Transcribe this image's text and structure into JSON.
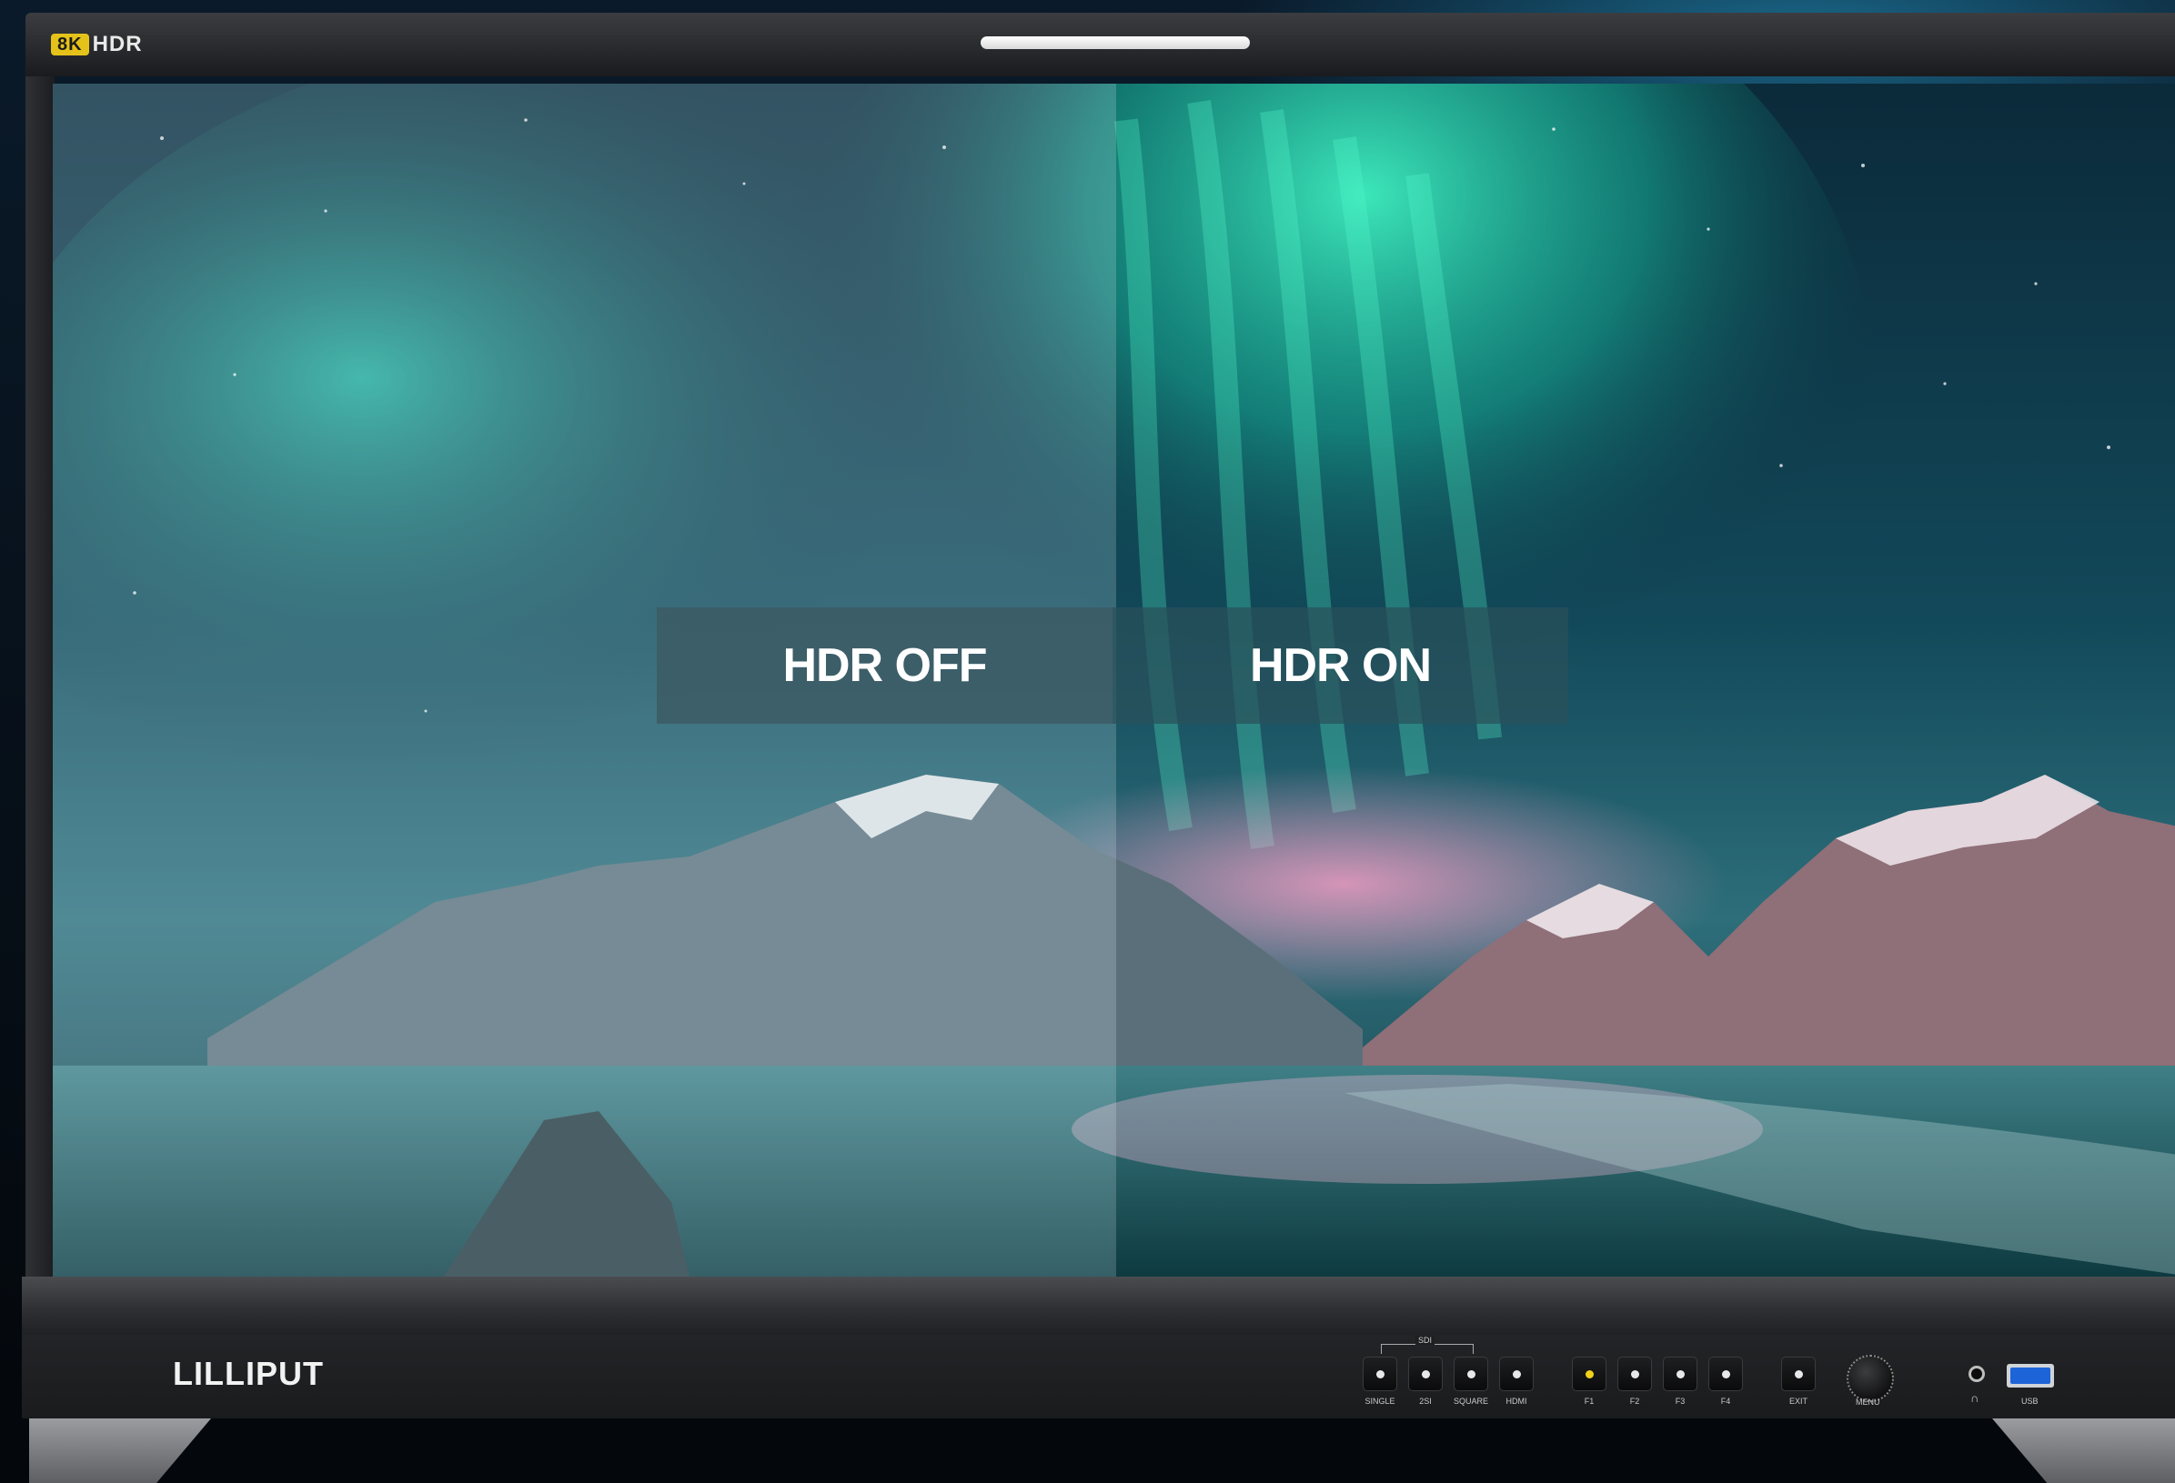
{
  "monitor": {
    "badge": {
      "eight_k": "8K",
      "hdr": "HDR"
    },
    "brand": "LILLIPUT"
  },
  "screen": {
    "left_label": "HDR OFF",
    "right_label": "HDR ON"
  },
  "controls": {
    "sdi_group_label": "SDI",
    "buttons": [
      {
        "label": "SINGLE"
      },
      {
        "label": "2SI"
      },
      {
        "label": "SQUARE"
      },
      {
        "label": "HDMI"
      },
      {
        "label": "F1"
      },
      {
        "label": "F2"
      },
      {
        "label": "F3"
      },
      {
        "label": "F4"
      },
      {
        "label": "EXIT"
      }
    ],
    "knob_label": "MENU",
    "usb_label": "USB"
  },
  "colors": {
    "accent_yellow": "#e5c21a",
    "aurora_green": "#2fe3b0",
    "usb_blue": "#1d64d8"
  },
  "icons": [
    "headphone-icon",
    "usb-port-icon",
    "menu-knob-icon"
  ]
}
